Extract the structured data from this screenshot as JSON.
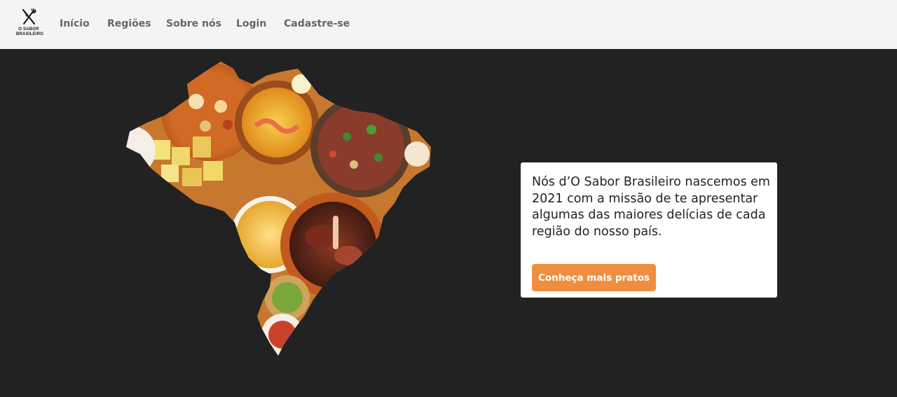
{
  "brand": {
    "line1": "O SABOR",
    "line2": "BRASILEIRO",
    "icon": "fork-knife-icon"
  },
  "nav": {
    "items": [
      {
        "label": "Início"
      },
      {
        "label": "Regiões"
      },
      {
        "label": "Sobre nós"
      },
      {
        "label": "Login"
      },
      {
        "label": "Cadastre-se"
      }
    ]
  },
  "hero": {
    "image": "brazil-map-food-collage"
  },
  "info": {
    "text": "Nós d’O Sabor Brasileiro nascemos em 2021 com a missão de te apresentar algumas das maiores delícias de cada região do nosso país.",
    "button_label": "Conheça mais pratos"
  },
  "colors": {
    "navbar_bg": "#f4f4f4",
    "page_bg": "#222222",
    "accent": "#ef8f3e",
    "nav_text": "#666666"
  }
}
